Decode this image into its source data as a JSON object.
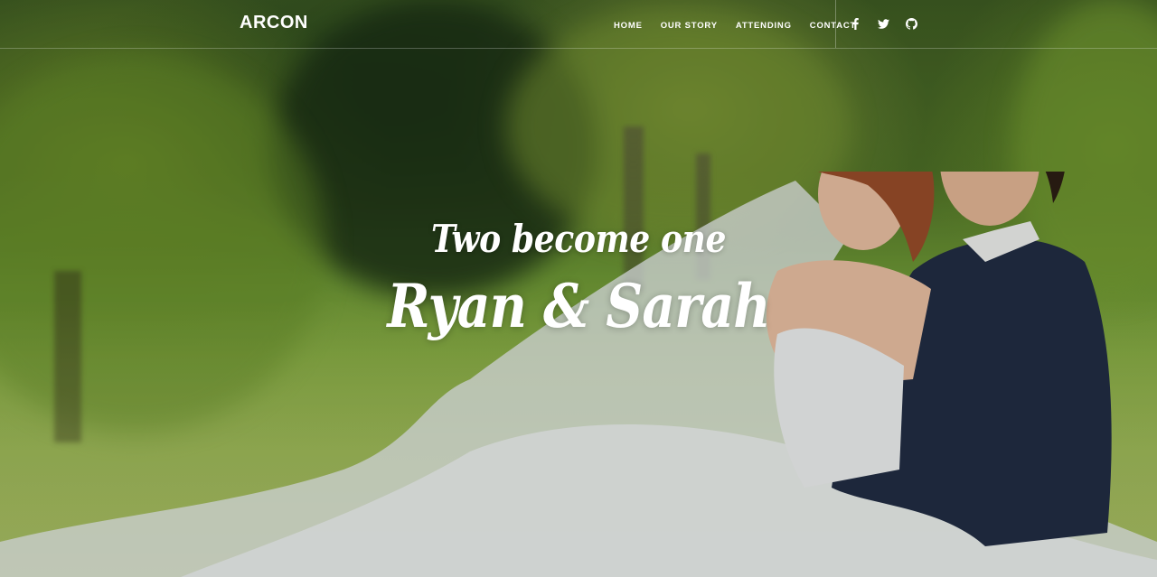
{
  "brand": {
    "name": "ARCON"
  },
  "nav": {
    "items": [
      {
        "label": "HOME"
      },
      {
        "label": "OUR STORY"
      },
      {
        "label": "ATTENDING"
      },
      {
        "label": "CONTACT"
      }
    ]
  },
  "social": {
    "icons": [
      "facebook-icon",
      "twitter-icon",
      "github-icon"
    ]
  },
  "hero": {
    "tagline": "Two become one",
    "names": "Ryan & Sarah"
  },
  "colors": {
    "text": "#ffffff",
    "foliage": "#6f9a35",
    "suit": "#1f2a44",
    "dress": "#f2f3f5"
  }
}
